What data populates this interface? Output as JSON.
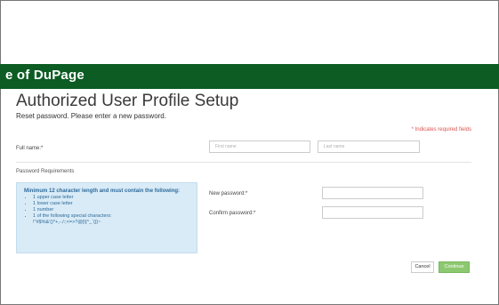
{
  "header": {
    "banner_text": "e of DuPage"
  },
  "page": {
    "title": "Authorized User Profile Setup",
    "subtitle": "Reset password. Please enter a new password.",
    "required_note": "* Indicates required fields"
  },
  "full_name": {
    "label": "Full name:*",
    "first_placeholder": "First name",
    "last_placeholder": "Last name"
  },
  "requirements": {
    "section_title": "Password Requirements",
    "heading": "Minimum 12 character length and must contain the following:",
    "items": [
      "1 upper case letter",
      "1 lower case letter",
      "1 number",
      "1 of the following special characters:"
    ],
    "special_chars": "!\"#$%&'()*+,-./:;<=>?@[\\]^_`{|}~"
  },
  "password": {
    "new_label": "New password:*",
    "confirm_label": "Confirm password:*"
  },
  "actions": {
    "cancel_label": "Cancel",
    "continue_label": "Continue"
  },
  "colors": {
    "banner": "#0c5c23",
    "continue": "#8cc870",
    "required": "#d9534f",
    "requirements_bg": "#d9ebf7"
  }
}
